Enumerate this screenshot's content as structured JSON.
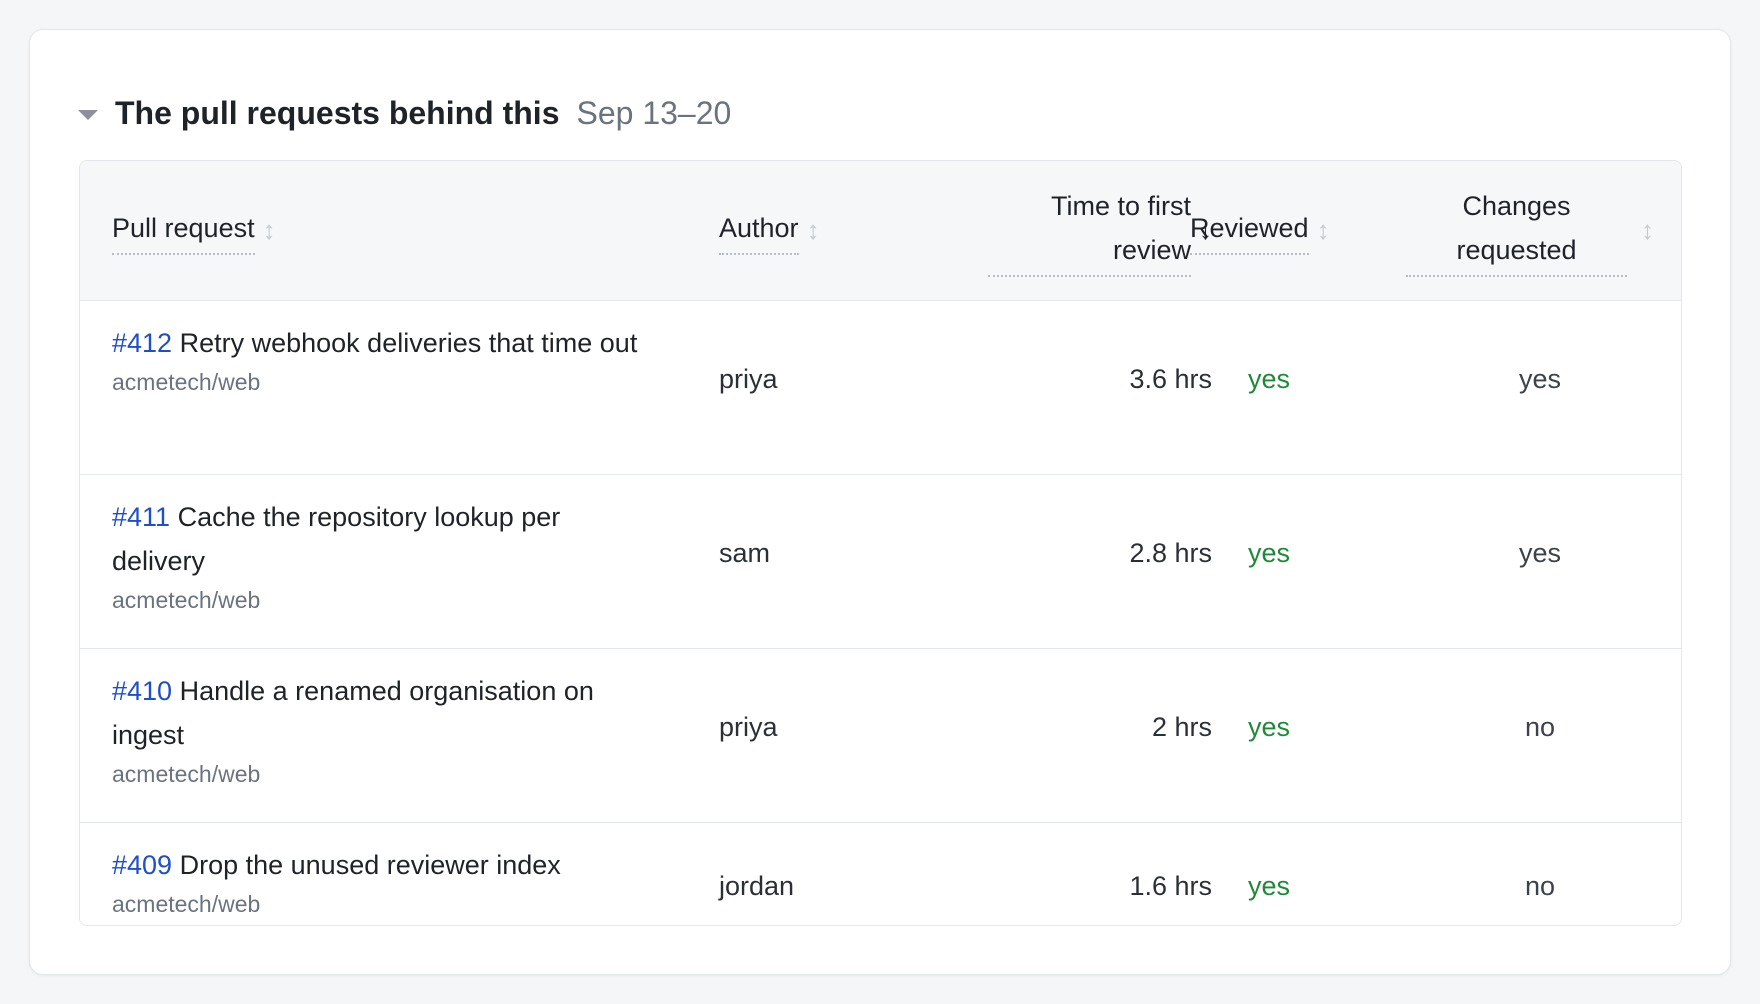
{
  "section": {
    "title": "The pull requests behind this",
    "range": "Sep 13–20"
  },
  "columns": {
    "pull_request": "Pull request",
    "author": "Author",
    "time_to_first_review_line1": "Time to first",
    "time_to_first_review_line2": "review",
    "reviewed": "Reviewed",
    "changes_requested_line1": "Changes",
    "changes_requested_line2": "requested"
  },
  "sort": {
    "active_column": "time_to_first_review",
    "direction": "descending"
  },
  "rows": [
    {
      "number": "#412",
      "title": "Retry webhook deliveries that time out",
      "repo": "acmetech/web",
      "author": "priya",
      "ttfr": "3.6 hrs",
      "reviewed": "yes",
      "changes": "yes"
    },
    {
      "number": "#411",
      "title": "Cache the repository lookup per delivery",
      "repo": "acmetech/web",
      "author": "sam",
      "ttfr": "2.8 hrs",
      "reviewed": "yes",
      "changes": "yes"
    },
    {
      "number": "#410",
      "title": "Handle a renamed organisation on ingest",
      "repo": "acmetech/web",
      "author": "priya",
      "ttfr": "2 hrs",
      "reviewed": "yes",
      "changes": "no"
    },
    {
      "number": "#409",
      "title": "Drop the unused reviewer index",
      "repo": "acmetech/web",
      "author": "jordan",
      "ttfr": "1.6 hrs",
      "reviewed": "yes",
      "changes": "no"
    }
  ],
  "colors": {
    "link": "#1f4fc8",
    "reviewed_yes": "#1f8a35",
    "muted": "#6b7380"
  },
  "icons": {
    "collapse": "caret-down-icon",
    "sortable": "sort-updown-icon",
    "sorted_desc": "arrow-down-icon"
  }
}
